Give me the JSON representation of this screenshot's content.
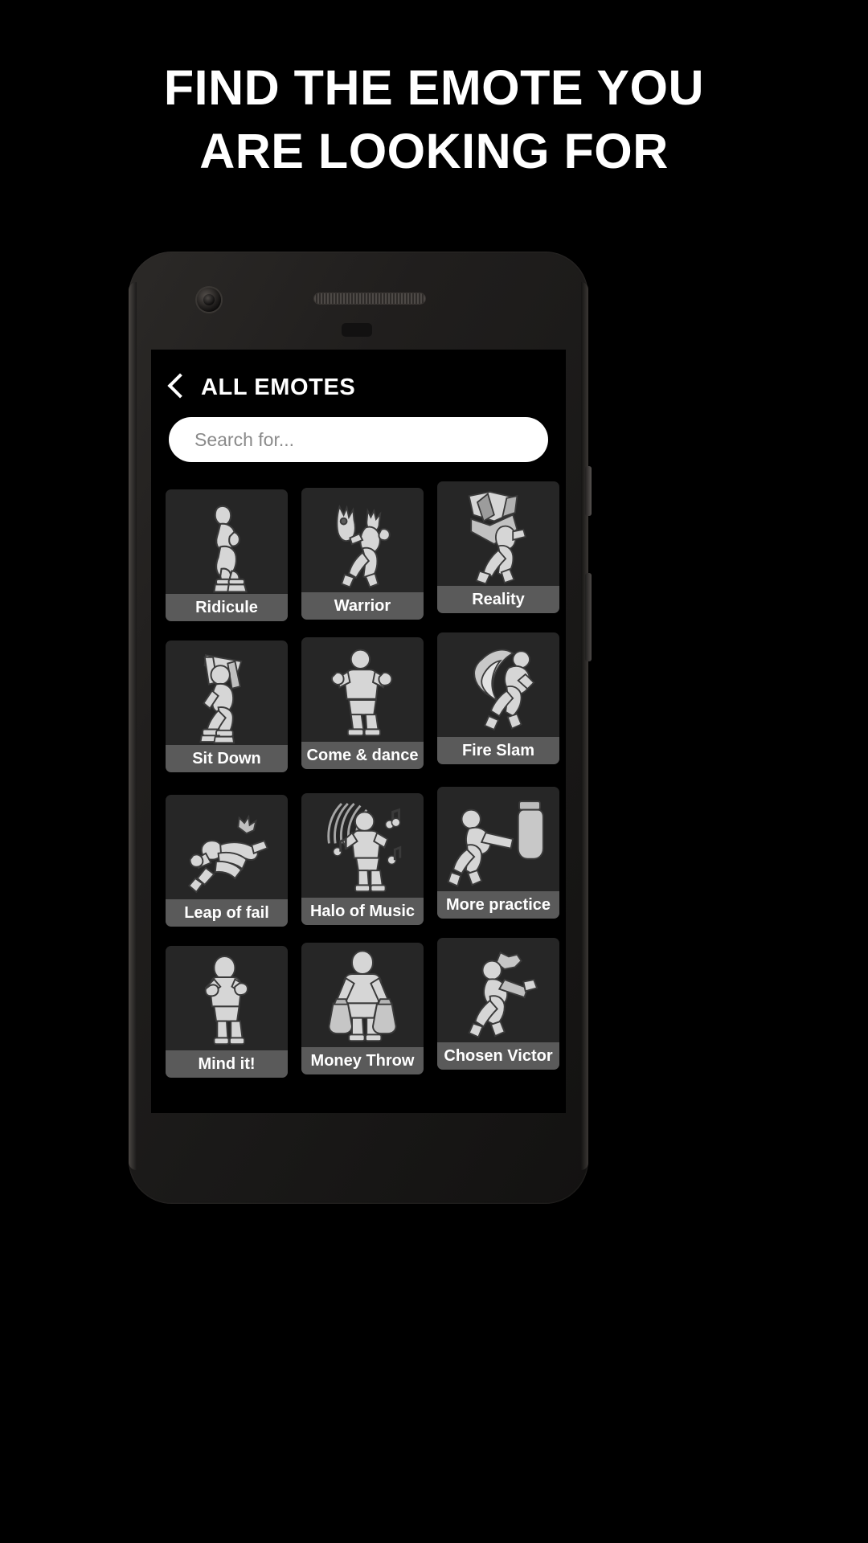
{
  "promo": {
    "headline_line1": "FIND THE EMOTE YOU",
    "headline_line2": "ARE LOOKING FOR",
    "background_color": "#000000",
    "headline_color": "#ffffff"
  },
  "device": {
    "camera_icon": "camera-lens",
    "speaker_icon": "earpiece-speaker",
    "sensor_icon": "proximity-sensor"
  },
  "app": {
    "header": {
      "back_icon": "chevron-left-icon",
      "title": "ALL EMOTES"
    },
    "search": {
      "placeholder": "Search for...",
      "value": "",
      "background_color": "#ffffff",
      "placeholder_color": "#8a8a8a"
    },
    "grid": {
      "tile_background": "#262626",
      "caption_background": "#5a5a5a",
      "figure_color": "#d6d6d6",
      "rows": [
        [
          {
            "name": "Ridicule",
            "art": "dance-hip-sway"
          },
          {
            "name": "Warrior",
            "art": "warrior-mask"
          },
          {
            "name": "Reality",
            "art": "reality-shatter"
          }
        ],
        [
          {
            "name": "Sit Down",
            "art": "sit-down-chair"
          },
          {
            "name": "Come & dance",
            "art": "come-and-dance"
          },
          {
            "name": "Fire Slam",
            "art": "fire-slam"
          }
        ],
        [
          {
            "name": "Leap of fail",
            "art": "leap-of-fail"
          },
          {
            "name": "Halo of Music",
            "art": "halo-of-music"
          },
          {
            "name": "More practice",
            "art": "more-practice-bag"
          }
        ],
        [
          {
            "name": "Mind it!",
            "art": "mind-it-pose"
          },
          {
            "name": "Money Throw",
            "art": "money-throw-bags"
          },
          {
            "name": "Chosen Victor",
            "art": "chosen-victor"
          }
        ]
      ]
    }
  }
}
